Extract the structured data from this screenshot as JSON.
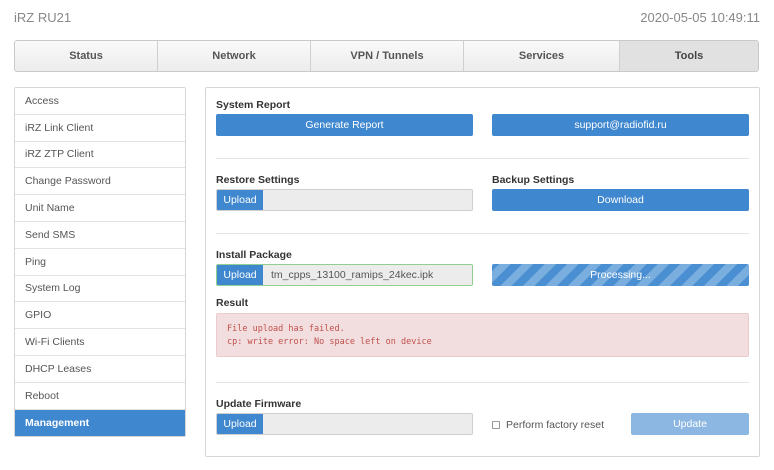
{
  "header": {
    "title": "iRZ RU21",
    "datetime": "2020-05-05 10:49:11"
  },
  "tabs": [
    {
      "label": "Status",
      "active": false
    },
    {
      "label": "Network",
      "active": false
    },
    {
      "label": "VPN / Tunnels",
      "active": false
    },
    {
      "label": "Services",
      "active": false
    },
    {
      "label": "Tools",
      "active": true
    }
  ],
  "sidebar": {
    "items": [
      {
        "label": "Access"
      },
      {
        "label": "iRZ Link Client"
      },
      {
        "label": "iRZ ZTP Client"
      },
      {
        "label": "Change Password"
      },
      {
        "label": "Unit Name"
      },
      {
        "label": "Send SMS"
      },
      {
        "label": "Ping"
      },
      {
        "label": "System Log"
      },
      {
        "label": "GPIO"
      },
      {
        "label": "Wi-Fi Clients"
      },
      {
        "label": "DHCP Leases"
      },
      {
        "label": "Reboot"
      },
      {
        "label": "Management",
        "active": true
      }
    ]
  },
  "system_report": {
    "title": "System Report",
    "generate_label": "Generate Report",
    "support_label": "support@radiofid.ru"
  },
  "restore": {
    "title": "Restore Settings",
    "upload_label": "Upload",
    "file": ""
  },
  "backup": {
    "title": "Backup Settings",
    "download_label": "Download"
  },
  "install": {
    "title": "Install Package",
    "upload_label": "Upload",
    "file": "tm_cpps_13100_ramips_24kec.ipk",
    "progress_label": "Processing...",
    "progress": 1.0
  },
  "result": {
    "title": "Result",
    "line1": "File upload has failed.",
    "line2": "cp: write error: No space left on device"
  },
  "firmware": {
    "title": "Update Firmware",
    "upload_label": "Upload",
    "file": "",
    "factory_reset_label": "Perform factory reset",
    "factory_reset_checked": false,
    "update_label": "Update"
  },
  "colors": {
    "primary": "#3f87cf",
    "primary_light": "#8cb7e3",
    "error_bg": "#f2dede",
    "error_text": "#c0504d"
  }
}
